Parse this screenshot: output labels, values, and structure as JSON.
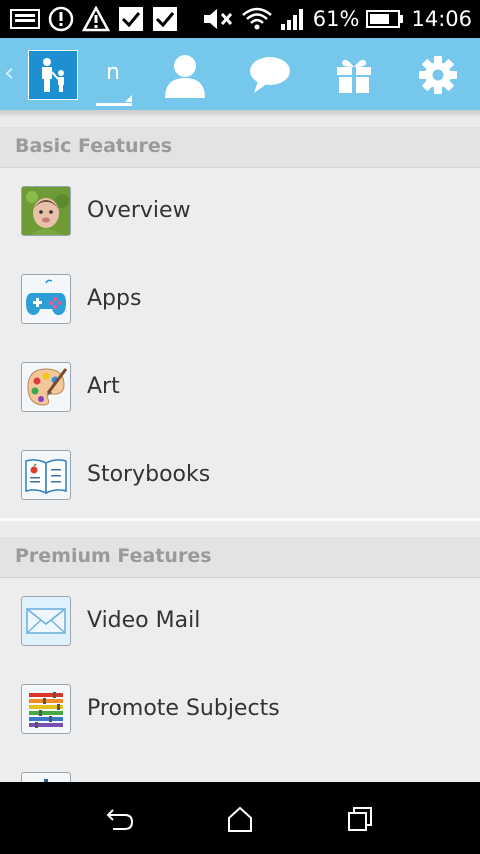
{
  "status_bar": {
    "battery_percent": "61%",
    "time": "14:06",
    "icons": [
      "screen-icon",
      "alert-circle-icon",
      "warning-icon",
      "check-icon",
      "check-icon",
      "mute-icon",
      "wifi-icon",
      "signal-icon",
      "battery-icon"
    ]
  },
  "header": {
    "back_glyph": "‹",
    "current_tab_label": "n",
    "tabs": [
      "family-icon",
      "profile-icon",
      "chat-icon",
      "gift-icon",
      "settings-icon"
    ],
    "colors": {
      "bar": "#75c7eb",
      "family_tile": "#1e8fd0"
    }
  },
  "sections": [
    {
      "title": "Basic Features",
      "items": [
        {
          "label": "Overview",
          "icon": "baby-photo-icon"
        },
        {
          "label": "Apps",
          "icon": "gamepad-icon"
        },
        {
          "label": "Art",
          "icon": "palette-icon"
        },
        {
          "label": "Storybooks",
          "icon": "book-icon"
        }
      ]
    },
    {
      "title": "Premium Features",
      "items": [
        {
          "label": "Video Mail",
          "icon": "envelope-icon"
        },
        {
          "label": "Promote Subjects",
          "icon": "sliders-icon"
        }
      ]
    }
  ],
  "nav_bar": {
    "buttons": [
      "back-icon",
      "home-icon",
      "recents-icon"
    ]
  }
}
